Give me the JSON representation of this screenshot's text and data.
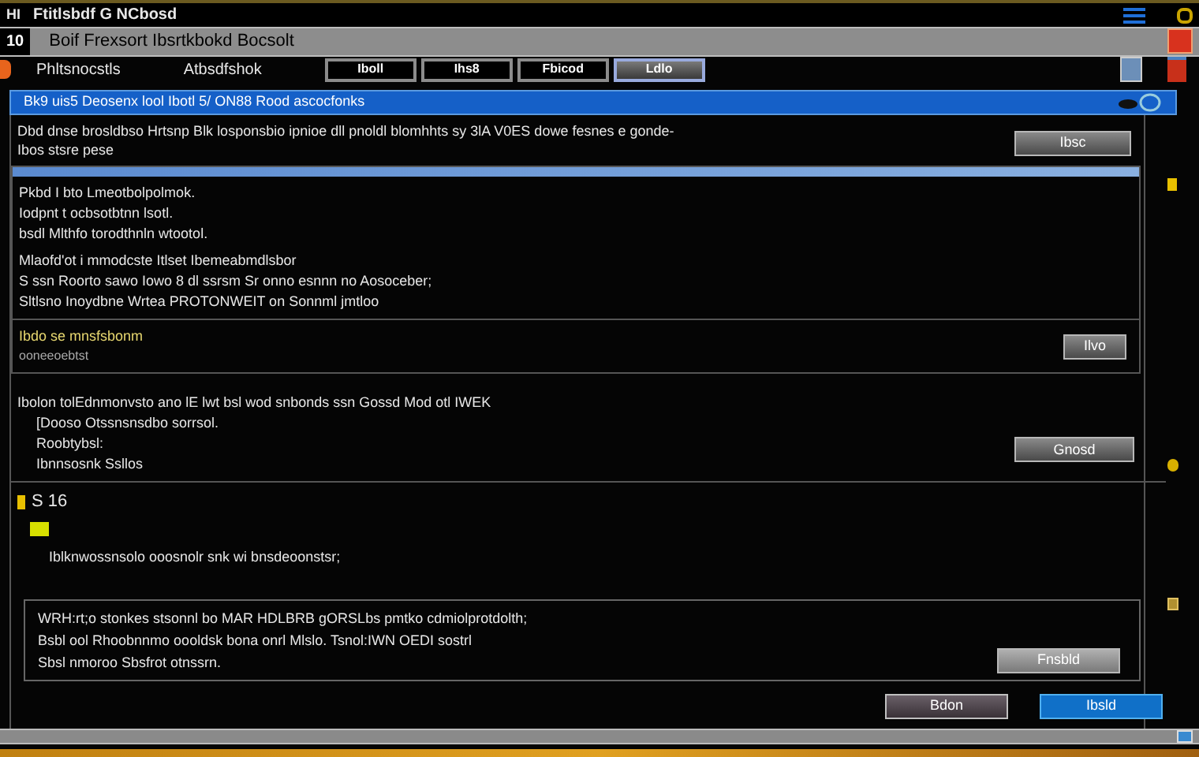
{
  "title_bar": {
    "badge": "HI",
    "title": "Ftitlsbdf G NCbosd"
  },
  "header": {
    "badge": "10",
    "title": "Boif Frexsort Ibsrtkbokd Bocsolt"
  },
  "toolbar": {
    "labels": [
      "Phltsnocstls",
      "Atbsdfshok"
    ],
    "buttons": [
      {
        "label": "Iboll",
        "kind": "outline"
      },
      {
        "label": "Ihs8",
        "kind": "outline"
      },
      {
        "label": "Fbicod",
        "kind": "outline"
      },
      {
        "label": "Ldlo",
        "kind": "filled"
      }
    ]
  },
  "section_bar": {
    "title": "Bk9 uis5 Deosenx lool Ibotl 5/ ON88 Rood ascocfonks"
  },
  "panel_1": {
    "intro": [
      "Dbd dnse brosldbso Hrtsnp Blk losponsbio ipnioe dll pnoldl blomhhts sy 3lA V0ES dowe fesnes e gonde-",
      "Ibos stsre pese"
    ],
    "intro_button": "Ibsc",
    "details": [
      "Pkbd I bto Lmeotbolpolmok.",
      "Iodpnt t ocbsotbtnn lsotl.",
      "bsdl Mlthfo torodthnln wtootol.",
      "Mlaofd'ot i mmodcste Itlset Ibemeabmdlsbor",
      "S ssn Roorto sawo Iowo 8 dl ssrsm  Sr onno esnnn no Aosoceber;",
      "Sltlsno Inoydbne Wrtea PROTONWEIT on Sonnml jmtloo"
    ],
    "footer_label": "Ibdo se mnsfsbonm",
    "footer_note": "ooneeoebtst",
    "footer_button": "Ilvo"
  },
  "panel_2": {
    "lines": [
      "Ibolon tolEdnmonvsto ano lE lwt bsl wod snbonds ssn Gossd Mod otl IWEK",
      "[Dooso Otssnsnsdbo sorrsol.",
      "Roobtybsl:",
      "Ibnnsosnk Ssllos"
    ],
    "button": "Gnosd"
  },
  "step": {
    "label": "S 16"
  },
  "option": {
    "text": "Iblknwossnsolo ooosnolr snk wi bnsdeoonstsr;"
  },
  "notes": {
    "lines": [
      "WRH:rt;o stonkes stsonnl bo MAR HDLBRB gORSLbs pmtko cdmiolprotdolth;",
      "Bsbl ool Rhoobnnmo oooldsk bona onrl Mlslo. Tsnol:IWN OEDI sostrl",
      "Sbsl nmoroo Sbsfrot otnssrn."
    ],
    "button": "Fnsbld"
  },
  "actions": [
    {
      "label": "Bdon",
      "primary": false
    },
    {
      "label": "Ibsld",
      "primary": true
    }
  ]
}
